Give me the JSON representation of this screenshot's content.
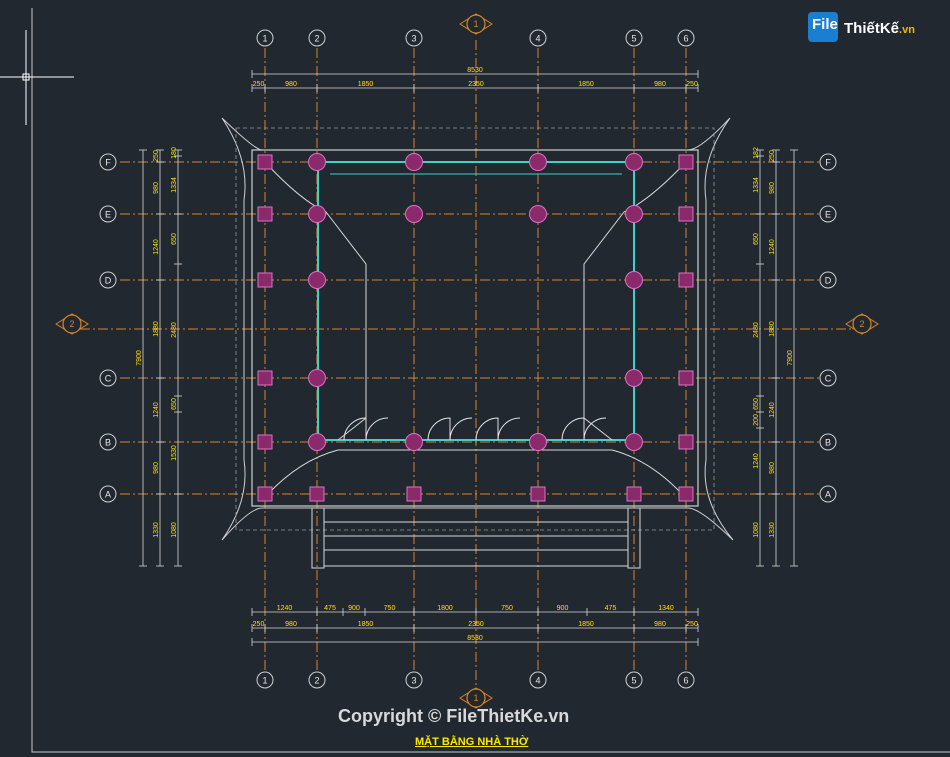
{
  "drawing": {
    "title": "MẶT BẰNG NHÀ THỜ",
    "copyright": "Copyright © FileThietKe.vn",
    "logo": {
      "file": "File",
      "brand": "ThiếtKế",
      "tld": ".vn"
    },
    "grid_cols": [
      "1",
      "2",
      "3",
      "4",
      "5",
      "6"
    ],
    "grid_rows": [
      "F",
      "E",
      "D",
      "C",
      "B",
      "A"
    ],
    "section_marks": [
      "1",
      "2"
    ],
    "dims_top": {
      "overall": "8530",
      "segments": [
        "250",
        "980",
        "1850",
        "2350",
        "1850",
        "980",
        "250"
      ]
    },
    "dims_bottom_detail": [
      "1240",
      "475",
      "900",
      "750",
      "1800",
      "750",
      "900",
      "475",
      "1340"
    ],
    "dims_bottom": {
      "overall": "8530",
      "segments": [
        "250",
        "980",
        "1850",
        "2350",
        "1850",
        "980",
        "250"
      ]
    },
    "dims_left_outer": {
      "overall": "7900",
      "segments": [
        "250",
        "980",
        "1240",
        "1880",
        "1240",
        "980",
        "1330"
      ]
    },
    "dims_left_inner": [
      "180",
      "1334",
      "650",
      "2480",
      "650",
      "1530",
      "1080"
    ],
    "dims_right_inner": [
      "182",
      "1334",
      "650",
      "2480",
      "650",
      "200",
      "1240",
      "1080"
    ],
    "dims_right_outer": {
      "overall": "7900",
      "segments": [
        "250",
        "980",
        "1240",
        "1880",
        "1240",
        "980",
        "1330"
      ]
    }
  }
}
